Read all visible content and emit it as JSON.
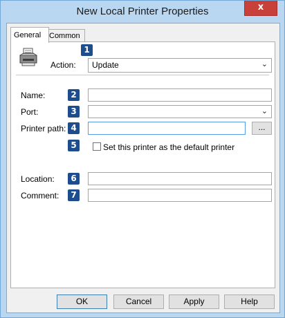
{
  "window": {
    "title": "New Local Printer Properties",
    "close_glyph": "x"
  },
  "tabs": [
    {
      "label": "General",
      "active": true
    },
    {
      "label": "Common",
      "active": false
    }
  ],
  "general": {
    "printer_icon": "printer-icon",
    "action": {
      "badge": "1",
      "label": "Action:",
      "value": "Update"
    },
    "name": {
      "badge": "2",
      "label": "Name:",
      "value": ""
    },
    "port": {
      "badge": "3",
      "label": "Port:",
      "value": ""
    },
    "printer_path": {
      "badge": "4",
      "label": "Printer path:",
      "value": "",
      "browse_label": "..."
    },
    "default_printer": {
      "badge": "5",
      "label": "Set this printer as the default printer",
      "checked": false
    },
    "location": {
      "badge": "6",
      "label": "Location:",
      "value": ""
    },
    "comment": {
      "badge": "7",
      "label": "Comment:",
      "value": ""
    }
  },
  "buttons": {
    "ok": "OK",
    "cancel": "Cancel",
    "apply": "Apply",
    "help": "Help"
  },
  "colors": {
    "badge": "#1d4d8c",
    "close": "#c8403a",
    "titlebar": "#b9d7f1"
  }
}
